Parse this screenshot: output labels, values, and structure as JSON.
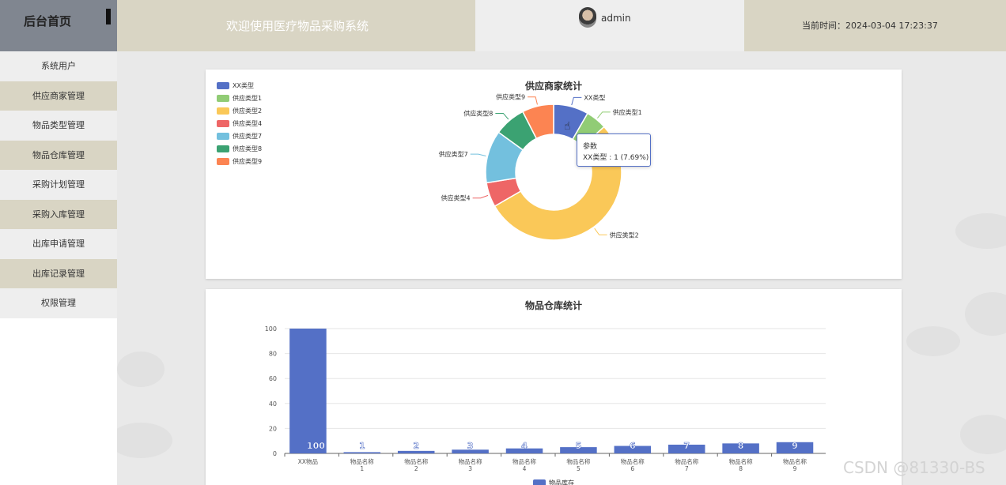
{
  "header": {
    "home": "后台首页",
    "title": "欢迎使用医疗物品采购系统",
    "username": "admin",
    "time_label": "当前时间：",
    "time_value": "2024-03-04 17:23:37"
  },
  "sidebar": {
    "items": [
      {
        "label": "系统用户"
      },
      {
        "label": "供应商家管理"
      },
      {
        "label": "物品类型管理"
      },
      {
        "label": "物品仓库管理"
      },
      {
        "label": "采购计划管理"
      },
      {
        "label": "采购入库管理"
      },
      {
        "label": "出库申请管理"
      },
      {
        "label": "出库记录管理"
      },
      {
        "label": "权限管理"
      }
    ]
  },
  "tooltip": {
    "title": "参数",
    "text": "XX类型 : 1 (7.69%)"
  },
  "watermark": "CSDN @81330-BS",
  "chart_data": [
    {
      "type": "pie",
      "title": "供应商家统计",
      "legend_position": "top-left",
      "slices": [
        {
          "name": "XX类型",
          "value": 1,
          "color": "#5470c6"
        },
        {
          "name": "供应类型1",
          "value": 0.6,
          "color": "#91cc75"
        },
        {
          "name": "供应类型2",
          "value": 6.4,
          "color": "#fac858"
        },
        {
          "name": "供应类型4",
          "value": 0.7,
          "color": "#ee6666"
        },
        {
          "name": "供应类型7",
          "value": 1.5,
          "color": "#73c0de"
        },
        {
          "name": "供应类型8",
          "value": 0.9,
          "color": "#3ba272"
        },
        {
          "name": "供应类型9",
          "value": 0.9,
          "color": "#fc8452"
        }
      ]
    },
    {
      "type": "bar",
      "title": "物品仓库统计",
      "categories": [
        "XX物品",
        "物品名称\n1",
        "物品名称\n2",
        "物品名称\n3",
        "物品名称\n4",
        "物品名称\n5",
        "物品名称\n6",
        "物品名称\n7",
        "物品名称\n8",
        "物品名称\n9"
      ],
      "series": [
        {
          "name": "物品库存",
          "values": [
            100,
            1,
            2,
            3,
            4,
            5,
            6,
            7,
            8,
            9
          ],
          "color": "#5470c6"
        }
      ],
      "ylim": [
        0,
        100
      ],
      "yticks": [
        0,
        20,
        40,
        60,
        80,
        100
      ],
      "grid": true,
      "legend_position": "bottom"
    }
  ]
}
